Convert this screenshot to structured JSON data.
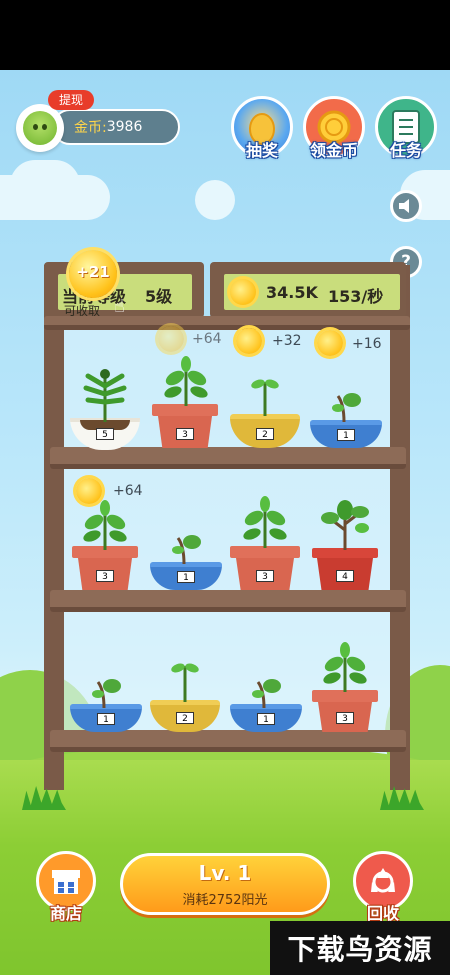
{
  "profile": {
    "withdraw_badge": "提现",
    "coin_label": "金币: ",
    "coin_value": "3986"
  },
  "top_buttons": {
    "lottery": "抽奖",
    "collect_coins": "领金币",
    "tasks": "任务"
  },
  "side_icons": {
    "sound": "speaker-icon",
    "help_symbol": "?"
  },
  "shelf": {
    "level_label": "当前等级",
    "level_value": "5级",
    "collect_badge": "+21",
    "collect_hint": "可收取",
    "sun_total": "34.5K",
    "sun_rate": "153/秒"
  },
  "sun_gains": [
    {
      "text": "+64",
      "faded": true
    },
    {
      "text": "+32"
    },
    {
      "text": "+16"
    },
    {
      "text": "+64"
    }
  ],
  "pots": [
    {
      "row": 1,
      "level": "5",
      "type": "white-bowl"
    },
    {
      "row": 1,
      "level": "3",
      "type": "terracotta"
    },
    {
      "row": 1,
      "level": "2",
      "type": "yellow-bowl"
    },
    {
      "row": 1,
      "level": "1",
      "type": "blue-bowl"
    },
    {
      "row": 2,
      "level": "3",
      "type": "terracotta"
    },
    {
      "row": 2,
      "level": "1",
      "type": "blue-bowl"
    },
    {
      "row": 2,
      "level": "3",
      "type": "terracotta"
    },
    {
      "row": 2,
      "level": "4",
      "type": "red-pot"
    },
    {
      "row": 3,
      "level": "1",
      "type": "blue-bowl"
    },
    {
      "row": 3,
      "level": "2",
      "type": "yellow-bowl"
    },
    {
      "row": 3,
      "level": "1",
      "type": "blue-bowl"
    },
    {
      "row": 3,
      "level": "3",
      "type": "terracotta"
    }
  ],
  "bottom": {
    "shop": "商店",
    "upgrade_title": "Lv. 1",
    "upgrade_cost": "消耗2752阳光",
    "recycle": "回收"
  },
  "watermark": "下载鸟资源"
}
